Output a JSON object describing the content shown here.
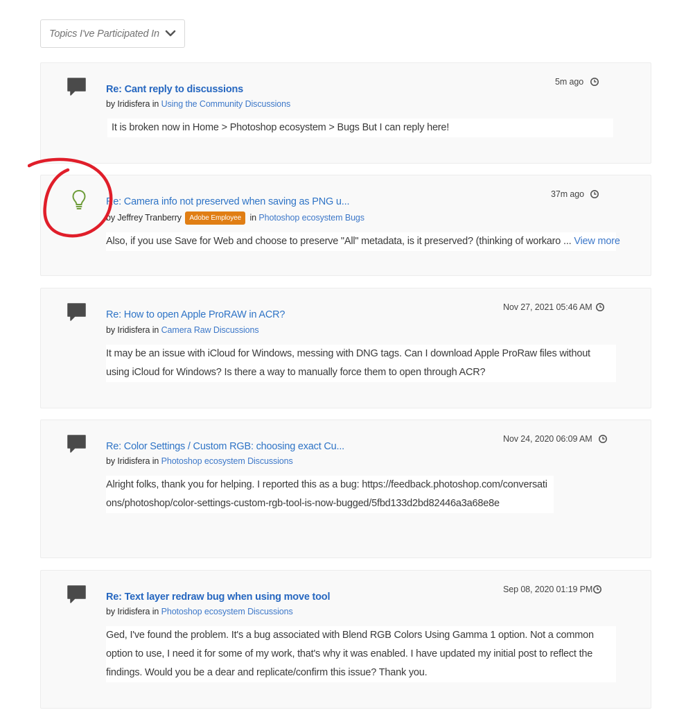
{
  "filter": {
    "label": "Topics I've Participated In",
    "icon": "chevron-down-icon"
  },
  "posts": [
    {
      "icon": "speech-bubble-icon",
      "title": "Re: Cant reply to discussions",
      "by": "by",
      "author": "Iridisfera",
      "in": "in",
      "board": "Using the Community Discussions",
      "time": "5m ago",
      "body": "It is broken now in Home > Photoshop ecosystem > Bugs But I can reply here!"
    },
    {
      "icon": "lightbulb-icon",
      "title": "Re: Camera info not preserved when saving as PNG u...",
      "by": "by",
      "author": "Jeffrey Tranberry",
      "badge": "Adobe Employee",
      "in": "in",
      "board": "Photoshop ecosystem Bugs",
      "time": "37m ago",
      "body": "Also, if you use Save for Web and choose to preserve \"All\" metadata, is it preserved? (thinking of workaro ...",
      "view_more": "View more"
    },
    {
      "icon": "speech-bubble-icon",
      "title": "Re: How to open Apple ProRAW in ACR?",
      "by": "by",
      "author": "Iridisfera",
      "in": "in",
      "board": "Camera Raw Discussions",
      "time": "Nov 27, 2021 05:46 AM",
      "body": "It may be an issue with iCloud for Windows, messing with DNG tags. Can I download Apple ProRaw files without using iCloud for Windows? Is there a way to manually force them to open through ACR?"
    },
    {
      "icon": "speech-bubble-icon",
      "title": "Re: Color Settings / Custom RGB: choosing exact Cu...",
      "by": "by",
      "author": "Iridisfera",
      "in": "in",
      "board": "Photoshop ecosystem Discussions",
      "time": "Nov 24, 2020 06:09 AM",
      "body": "Alright folks, thank you for helping.   I reported this as a bug: https://feedback.photoshop.com/conversations/photoshop/color-settings-custom-rgb-tool-is-now-bugged/5fbd133d2bd82446a3a68e8e"
    },
    {
      "icon": "speech-bubble-icon",
      "title": "Re: Text layer redraw bug when using move tool",
      "by": "by",
      "author": "Iridisfera",
      "in": "in",
      "board": "Photoshop ecosystem Discussions",
      "time": "Sep 08, 2020 01:19 PM",
      "body": "Ged, I've found the problem. It's a bug associated with  Blend RGB Colors Using Gamma 1 option. Not a common option to use, I need it for some of my work, that's why it was enabled.   I have updated my initial post to reflect the findings. Would you be a dear and replicate/confirm this issue?   Thank you."
    }
  ],
  "colors": {
    "link": "#2f74c6",
    "badge": "#e07e14",
    "annotation": "#e01e2a",
    "lightbulb": "#6e9d3a",
    "card_bg": "#f9f9f9"
  }
}
